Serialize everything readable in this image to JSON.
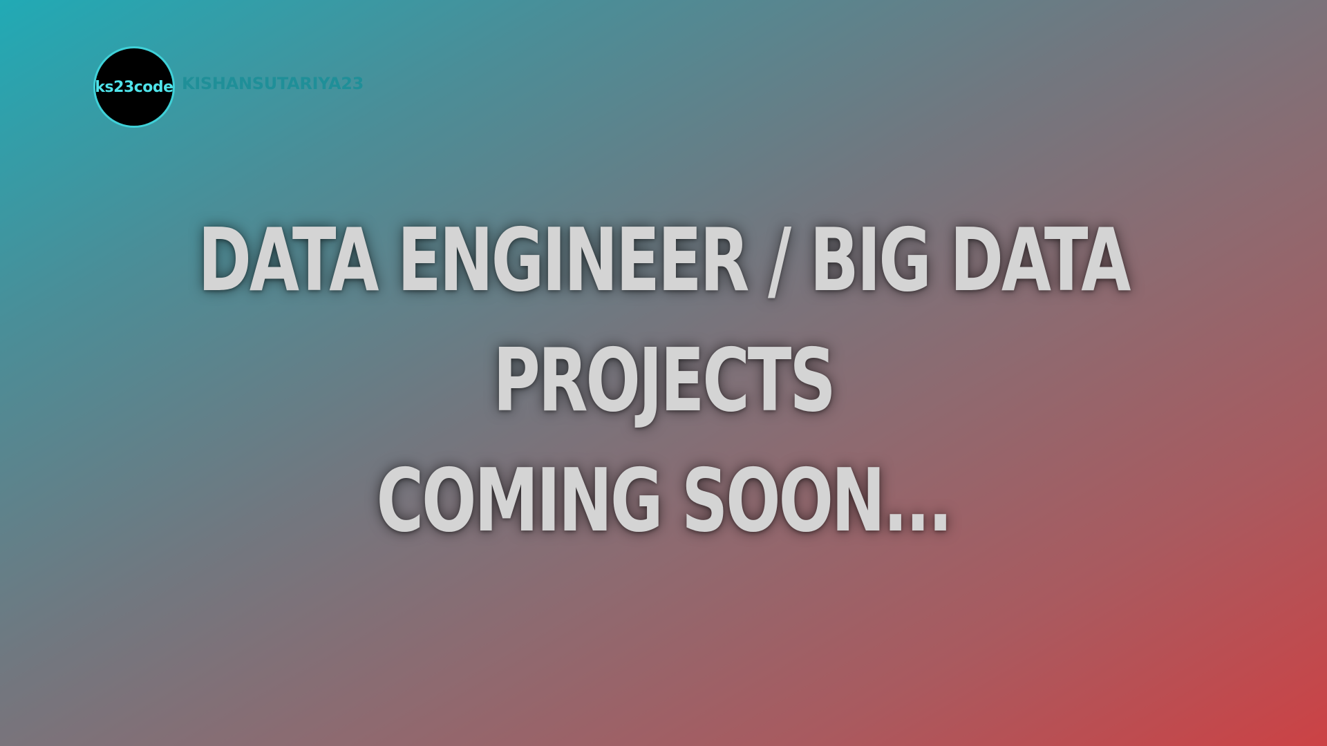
{
  "brand": {
    "logo_text": "ks23code",
    "handle": "KISHANSUTARIYA23"
  },
  "headline": {
    "line1": "DATA ENGINEER / BIG DATA",
    "line2": "PROJECTS",
    "line3": "COMING SOON..."
  },
  "colors": {
    "gradient_start": "#21aab5",
    "gradient_end": "#cc4245",
    "logo_ring": "#3fd1d8",
    "logo_text": "#4fe3ea",
    "handle_text": "#1f8f98",
    "headline_text": "#d4d4d4"
  }
}
